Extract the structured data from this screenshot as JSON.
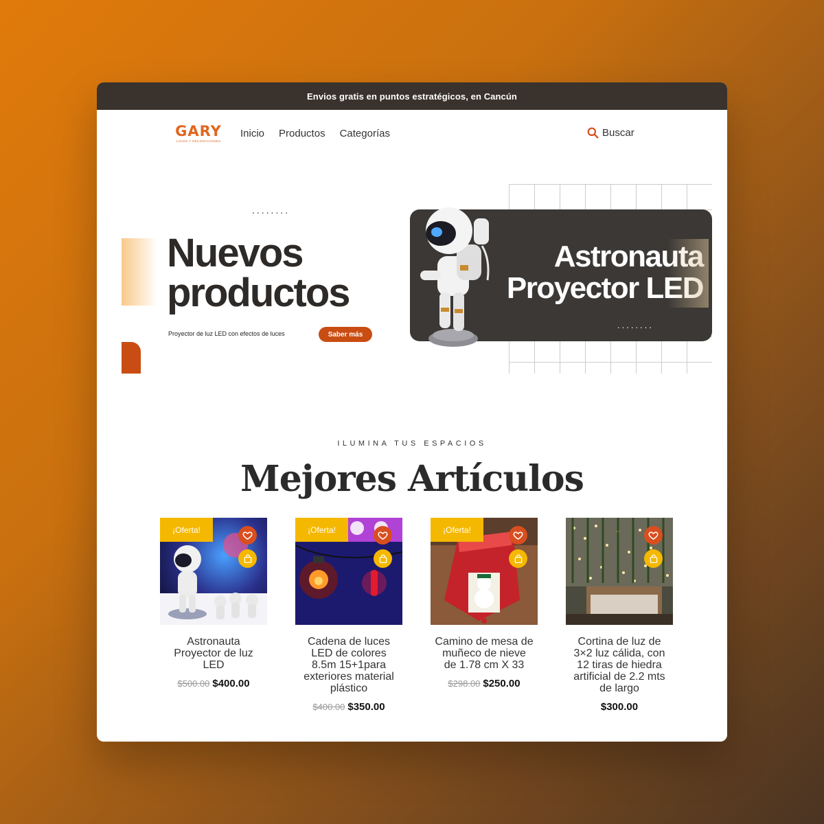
{
  "topbar": {
    "text": "Envios gratis en puntos estratégicos, en Cancún"
  },
  "logo": {
    "main": "GARY",
    "sub": "LUCES Y DECORACIONES"
  },
  "menu": {
    "items": [
      "Inicio",
      "Productos",
      "Categorías"
    ]
  },
  "search": {
    "label": "Buscar",
    "icon": "search-icon"
  },
  "hero": {
    "dots": "........",
    "title_line1": "Nuevos",
    "title_line2": "productos",
    "subtitle": "Proyector de luz LED con efectos de luces",
    "button": "Saber más",
    "product_line1": "Astronauta",
    "product_line2": "Proyector LED"
  },
  "section": {
    "label": "ILUMINA TUS ESPACIOS",
    "title": "Mejores Artículos"
  },
  "products": [
    {
      "badge": "¡Oferta!",
      "title": "Astronauta Proyector de luz LED",
      "old_price": "$500.00",
      "price": "$400.00"
    },
    {
      "badge": "¡Oferta!",
      "title": "Cadena de luces LED de colores 8.5m 15+1para exteriores material plástico",
      "old_price": "$400.00",
      "price": "$350.00"
    },
    {
      "badge": "¡Oferta!",
      "title": "Camino de mesa de muñeco de nieve de 1.78 cm X 33",
      "old_price": "$298.00",
      "price": "$250.00"
    },
    {
      "badge": "",
      "title": "Cortina de luz de 3×2 luz cálida, con 12 tiras de hiedra artificial de 2.2 mts de largo",
      "old_price": "",
      "price": "$300.00"
    }
  ],
  "colors": {
    "accent": "#c94d12",
    "yellow": "#f5b800",
    "dark": "#3b3835",
    "topbar": "#3a322c"
  }
}
